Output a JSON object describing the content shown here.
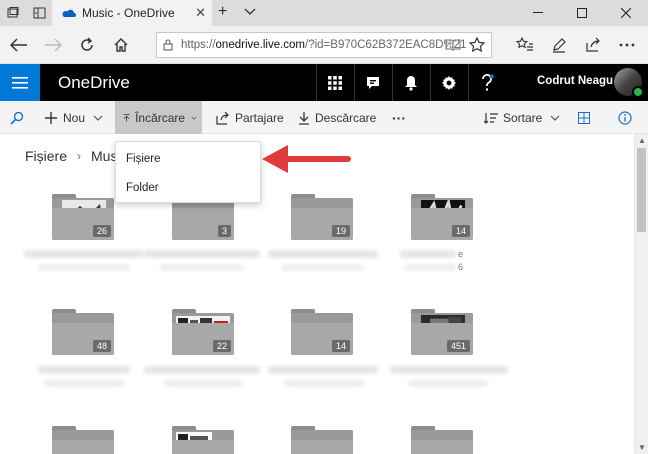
{
  "browser": {
    "tab_title": "Music - OneDrive",
    "close_tab_label": "✕",
    "new_tab_label": "+",
    "address": {
      "scheme": "https://",
      "host": "onedrive.live.com",
      "path": "/?id=B970C62B372EAC8D%21"
    }
  },
  "onedrive": {
    "brand": "OneDrive",
    "user_name": "Codrut Neagu"
  },
  "commands": {
    "new": "Nou",
    "upload": "Încărcare",
    "share": "Partajare",
    "download": "Descărcare",
    "more": "···",
    "sort": "Sortare"
  },
  "breadcrumb": {
    "root": "Fișiere",
    "current": "Music"
  },
  "upload_menu": {
    "items": [
      "Fișiere",
      "Folder"
    ]
  },
  "folders": [
    {
      "count": "26"
    },
    {
      "count": "3"
    },
    {
      "count": "19"
    },
    {
      "count": "14"
    },
    {
      "count": "48"
    },
    {
      "count": "22"
    },
    {
      "count": "14"
    },
    {
      "count": "451"
    }
  ],
  "side_chars": [
    "e",
    "6"
  ],
  "colors": {
    "accent": "#0078d7",
    "header_bg": "#000000",
    "arrow": "#e03a3a"
  }
}
